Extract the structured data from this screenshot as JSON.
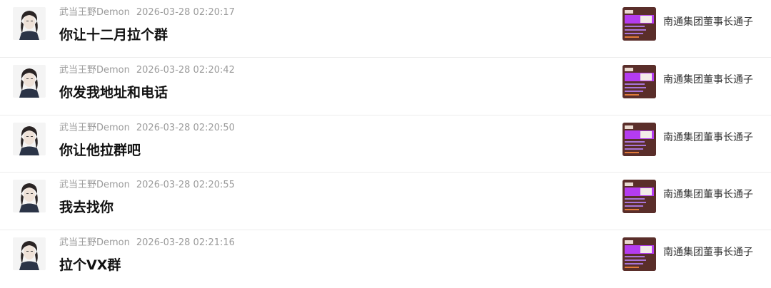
{
  "comments": [
    {
      "author": "武当王野Demon",
      "time": "2026-03-28 02:20:17",
      "text": "你让十二月拉个群",
      "target_title": "南通集团董事长通子"
    },
    {
      "author": "武当王野Demon",
      "time": "2026-03-28 02:20:42",
      "text": "你发我地址和电话",
      "target_title": "南通集团董事长通子"
    },
    {
      "author": "武当王野Demon",
      "time": "2026-03-28 02:20:50",
      "text": "你让他拉群吧",
      "target_title": "南通集团董事长通子"
    },
    {
      "author": "武当王野Demon",
      "time": "2026-03-28 02:20:55",
      "text": "我去找你",
      "target_title": "南通集团董事长通子"
    },
    {
      "author": "武当王野Demon",
      "time": "2026-03-28 02:21:16",
      "text": "拉个VX群",
      "target_title": "南通集团董事长通子"
    }
  ],
  "colors": {
    "meta_text": "#9b9b9b",
    "message_text": "#111111",
    "divider": "#ececec",
    "thumb_bg": "#5a2e2a",
    "thumb_accent": "#b43cf0"
  }
}
